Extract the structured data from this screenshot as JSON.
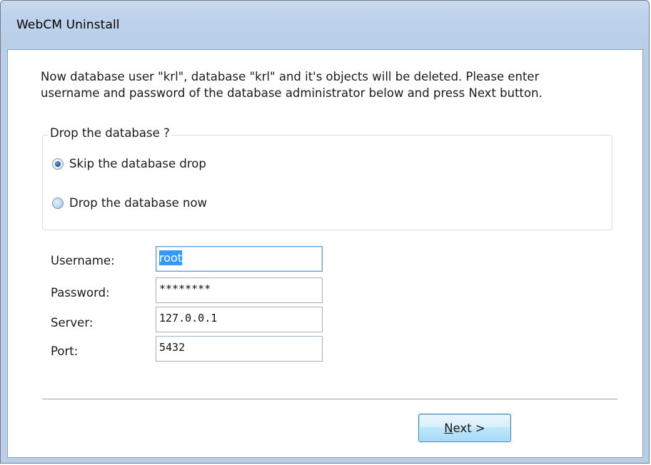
{
  "window": {
    "title": "WebCM Uninstall"
  },
  "intro": {
    "line1": "Now database user \"krl\", database \"krl\" and it's objects will be deleted. Please enter",
    "line2": "username and password of the database administrator below and press Next button."
  },
  "drop_group": {
    "legend": "Drop the database ?",
    "options": [
      {
        "label": "Skip the database drop",
        "checked": true
      },
      {
        "label": "Drop the database now",
        "checked": false
      }
    ]
  },
  "fields": {
    "username": {
      "label": "Username:",
      "value": "root"
    },
    "password": {
      "label": "Password:",
      "value": "********"
    },
    "server": {
      "label": "Server:",
      "value": "127.0.0.1"
    },
    "port": {
      "label": "Port:",
      "value": "5432"
    }
  },
  "buttons": {
    "next_mnemonic": "N",
    "next_rest": "ext >"
  },
  "colors": {
    "accent": "#3399ff",
    "window_frame": "#b9cfe8"
  }
}
